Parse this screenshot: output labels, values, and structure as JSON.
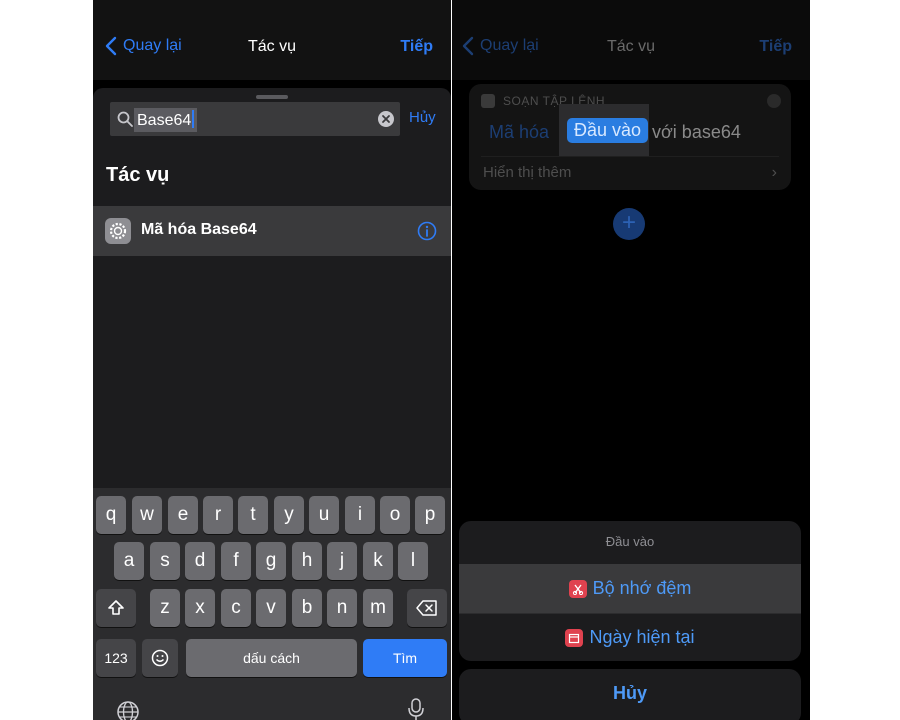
{
  "left": {
    "nav": {
      "back": "Quay lại",
      "title": "Tác vụ",
      "next": "Tiếp"
    },
    "search": {
      "query": "Base64",
      "cancel": "Hủy"
    },
    "section_title": "Tác vụ",
    "result": {
      "label": "Mã hóa Base64"
    },
    "keyboard": {
      "row1": [
        "q",
        "w",
        "e",
        "r",
        "t",
        "y",
        "u",
        "i",
        "o",
        "p"
      ],
      "row2": [
        "a",
        "s",
        "d",
        "f",
        "g",
        "h",
        "j",
        "k",
        "l"
      ],
      "row3": [
        "z",
        "x",
        "c",
        "v",
        "b",
        "n",
        "m"
      ],
      "numbers": "123",
      "space": "dấu cách",
      "go": "Tìm"
    }
  },
  "right": {
    "nav": {
      "back": "Quay lại",
      "title": "Tác vụ",
      "next": "Tiếp"
    },
    "card": {
      "header": "SOẠN TẬP LỆNH",
      "verb": "Mã hóa",
      "input": "Đầu vào",
      "tail": "với base64",
      "more": "Hiển thị thêm"
    },
    "popup": {
      "title": "Đầu vào",
      "options": [
        "Bộ nhớ đệm",
        "Ngày hiện tại"
      ],
      "cancel": "Hủy"
    }
  }
}
